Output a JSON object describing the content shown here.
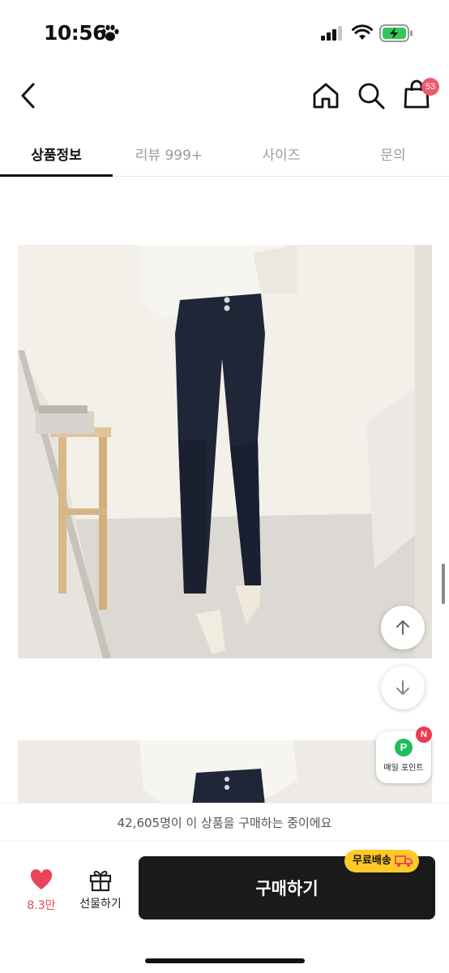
{
  "status_bar": {
    "time": "10:56"
  },
  "header": {
    "cart_count": "53"
  },
  "tabs": [
    {
      "label": "상품정보",
      "active": true
    },
    {
      "label": "리뷰 999+",
      "active": false
    },
    {
      "label": "사이즈",
      "active": false
    },
    {
      "label": "문의",
      "active": false
    }
  ],
  "points": {
    "p_letter": "P",
    "label": "매일 포인트",
    "new_badge": "N"
  },
  "purchase_notice": "42,605명이 이 상품을 구매하는 중이에요",
  "bottom_bar": {
    "like_count": "8.3만",
    "gift_label": "선물하기",
    "buy_label": "구매하기",
    "free_shipping_label": "무료배송"
  },
  "colors": {
    "accent_red": "#e8445a",
    "badge_red": "#ef5a68",
    "free_shipping_yellow": "#ffc928",
    "buy_button_bg": "#1a1a1a",
    "points_green": "#1fbd5b"
  },
  "icons": [
    "paw-icon",
    "signal-icon",
    "wifi-icon",
    "battery-charging-icon",
    "back-icon",
    "home-icon",
    "search-icon",
    "shopping-bag-icon",
    "arrow-up-icon",
    "arrow-down-icon",
    "heart-icon",
    "gift-icon",
    "truck-icon"
  ]
}
